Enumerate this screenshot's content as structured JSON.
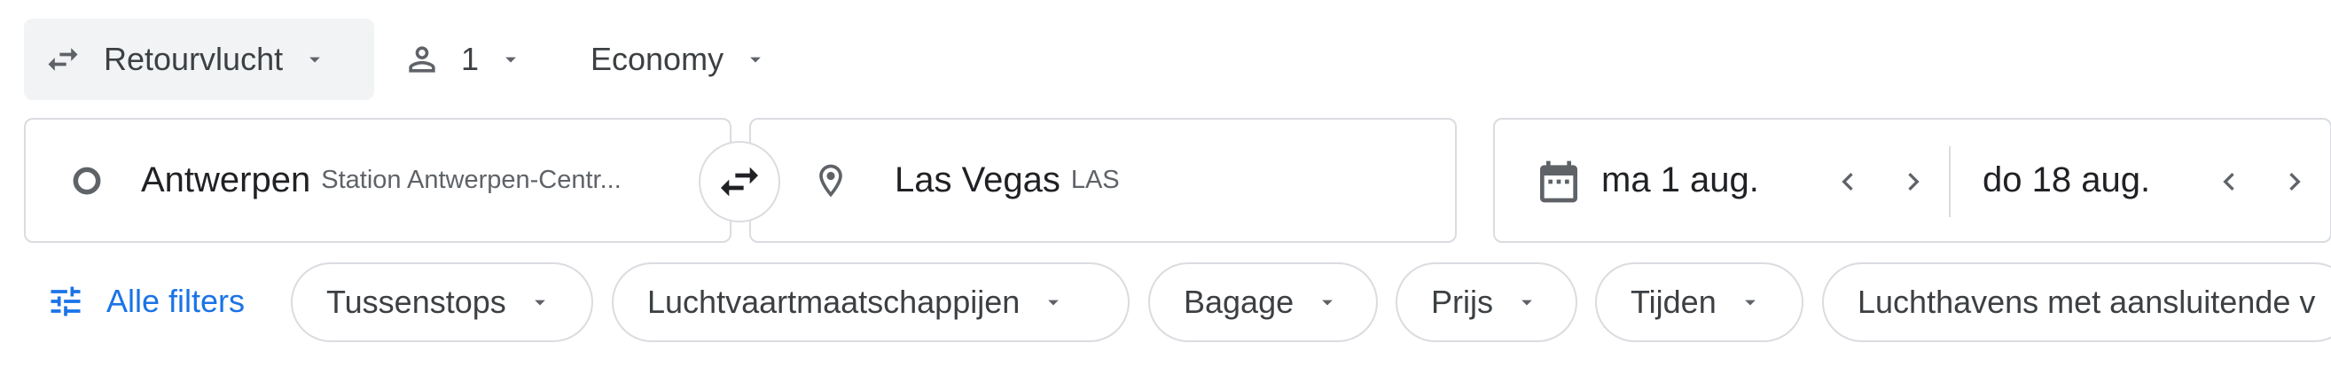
{
  "top_bar": {
    "trip_type": "Retourvlucht",
    "passengers": "1",
    "cabin_class": "Economy"
  },
  "search": {
    "origin": {
      "city": "Antwerpen",
      "detail": "Station Antwerpen-Centr..."
    },
    "destination": {
      "city": "Las Vegas",
      "detail": "LAS"
    },
    "departure_date": "ma 1 aug.",
    "return_date": "do 18 aug."
  },
  "filters": {
    "all_filters": "Alle filters",
    "chips": [
      "Tussenstops",
      "Luchtvaartmaatschappijen",
      "Bagage",
      "Prijs",
      "Tijden",
      "Luchthavens met aansluitende v"
    ]
  },
  "colors": {
    "accent": "#1a73e8",
    "text": "#3c4043",
    "border": "#dadce0",
    "trip_bg": "#f1f3f4"
  },
  "icons": [
    "swap-arrows-icon",
    "person-icon",
    "caret-down-icon",
    "origin-circle-icon",
    "swap-icon",
    "location-pin-icon",
    "calendar-icon",
    "chevron-left-icon",
    "chevron-right-icon",
    "tune-icon"
  ]
}
